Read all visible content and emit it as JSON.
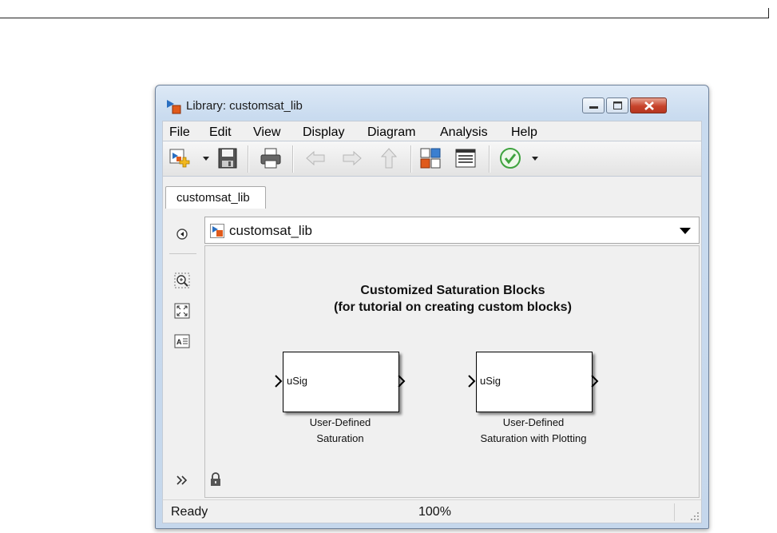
{
  "window": {
    "title": "Library: customsat_lib",
    "controls": [
      "minimize-icon",
      "maximize-icon",
      "close-icon"
    ]
  },
  "menu": [
    "File",
    "Edit",
    "View",
    "Display",
    "Diagram",
    "Analysis",
    "Help"
  ],
  "toolbar": {
    "icons": [
      "new-model-icon",
      "save-icon",
      "print-icon",
      "back-arrow-icon",
      "forward-arrow-icon",
      "up-arrow-icon",
      "library-browser-icon",
      "model-explorer-icon",
      "check-advisor-icon"
    ]
  },
  "tab": {
    "label": "customsat_lib"
  },
  "address": {
    "path": "customsat_lib"
  },
  "canvas": {
    "heading_line1": "Customized Saturation Blocks",
    "heading_line2": "(for tutorial on creating custom blocks)",
    "blocks": [
      {
        "port_label": "uSig",
        "caption_line1": "User-Defined",
        "caption_line2": "Saturation"
      },
      {
        "port_label": "uSig",
        "caption_line1": "User-Defined",
        "caption_line2": "Saturation with Plotting"
      }
    ]
  },
  "status": {
    "text": "Ready",
    "zoom": "100%"
  },
  "colors": {
    "close_button": "#c7432b",
    "titlebar": "#c9dbef",
    "check_green": "#3fa33f"
  }
}
